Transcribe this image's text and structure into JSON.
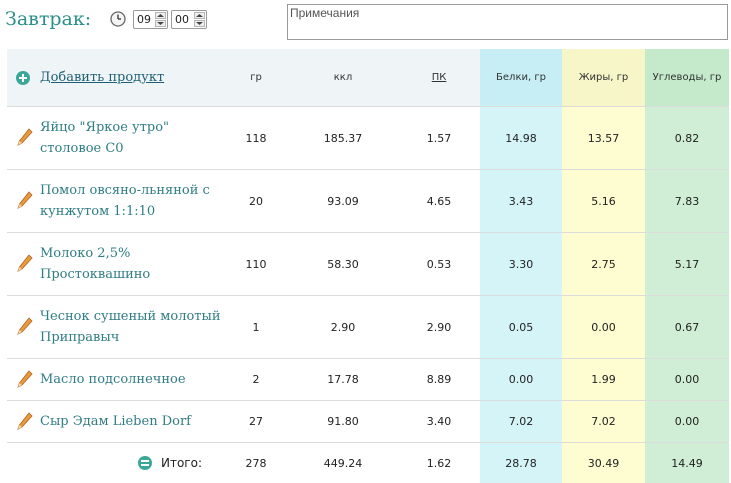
{
  "meal": {
    "title": "Завтрак:",
    "hour": "09",
    "minute": "00"
  },
  "notes": {
    "placeholder": "Примечания"
  },
  "table": {
    "add_product": "Добавить продукт",
    "headers": {
      "grams": "гр",
      "kcal": "ккл",
      "pk": "ПК",
      "protein": "Белки, гр",
      "fat": "Жиры, гр",
      "carbs": "Углеводы, гр"
    },
    "rows": [
      {
        "name": "Яйцо \"Яркое утро\" столовое С0",
        "grams": "118",
        "kcal": "185.37",
        "pk": "1.57",
        "protein": "14.98",
        "fat": "13.57",
        "carbs": "0.82"
      },
      {
        "name": "Помол овсяно-льняной с кунжутом 1:1:10",
        "grams": "20",
        "kcal": "93.09",
        "pk": "4.65",
        "protein": "3.43",
        "fat": "5.16",
        "carbs": "7.83"
      },
      {
        "name": "Молоко 2,5% Простоквашино",
        "grams": "110",
        "kcal": "58.30",
        "pk": "0.53",
        "protein": "3.30",
        "fat": "2.75",
        "carbs": "5.17"
      },
      {
        "name": "Чеснок сушеный молотый Приправыч",
        "grams": "1",
        "kcal": "2.90",
        "pk": "2.90",
        "protein": "0.05",
        "fat": "0.00",
        "carbs": "0.67"
      },
      {
        "name": "Масло подсолнечное",
        "grams": "2",
        "kcal": "17.78",
        "pk": "8.89",
        "protein": "0.00",
        "fat": "1.99",
        "carbs": "0.00"
      },
      {
        "name": "Сыр Эдам Lieben Dorf",
        "grams": "27",
        "kcal": "91.80",
        "pk": "3.40",
        "protein": "7.02",
        "fat": "7.02",
        "carbs": "0.00"
      }
    ],
    "total": {
      "label": "Итого:",
      "grams": "278",
      "kcal": "449.24",
      "pk": "1.62",
      "protein": "28.78",
      "fat": "30.49",
      "carbs": "14.49"
    }
  },
  "colors": {
    "protein": "#d5f4f8",
    "fat": "#fdfdd1",
    "carbs": "#cfeed5",
    "accent": "#2a8f8a",
    "link": "#2f7d84"
  },
  "icons": {
    "time": "clock-icon",
    "add": "plus-circle-icon",
    "edit": "pencil-icon",
    "total": "equals-circle-icon"
  }
}
